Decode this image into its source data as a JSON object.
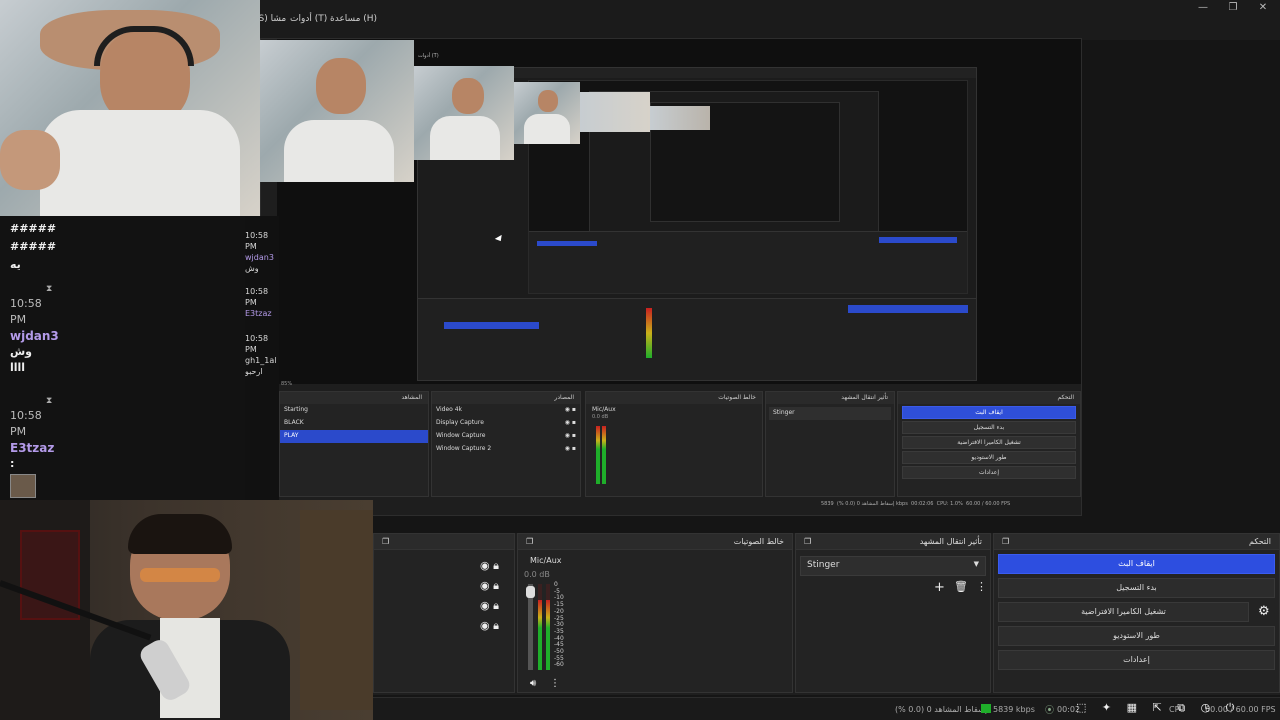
{
  "menubar": {
    "help": "مساعدة (H)",
    "tools": "أدوات (T)",
    "scenes_menu": "(S) مشا"
  },
  "window_controls": {
    "minimize": "—",
    "maximize": "❐",
    "close": "✕"
  },
  "chat": {
    "lines": [
      {
        "text": "#####"
      },
      {
        "text": "#####"
      },
      {
        "text": "يه"
      },
      {
        "time": "10:58",
        "ampm": "PM",
        "user": "wjdan3",
        "msg": "وش",
        "msg2": ":"
      },
      {
        "msg": "اااا"
      },
      {
        "time": "10:58",
        "ampm": "PM",
        "user": "E3tzaz",
        "msg": ":"
      }
    ]
  },
  "chat_mini": {
    "lines": [
      {
        "time": "10:58",
        "ampm": "PM",
        "user": "wjdan3",
        "msg": "وش"
      },
      {
        "time": "10:58",
        "ampm": "PM",
        "user": "E3tzaz"
      },
      {
        "time": "10:58",
        "ampm": "PM",
        "user": "gh1_1al",
        "msg": "ارحبو"
      }
    ]
  },
  "inner": {
    "toolbar_zoom": "85%",
    "scenes": {
      "title": "المشاهد",
      "items": [
        "Starting",
        "BLACK",
        "PLAY"
      ],
      "selected": 2
    },
    "sources": {
      "title": "المصادر",
      "items": [
        "Video 4k",
        "Display Capture",
        "Window Capture",
        "Window Capture 2"
      ]
    },
    "mixer": {
      "title": "خالط الصوتيات",
      "channel": "Mic/Aux",
      "db": "0.0 dB"
    },
    "transitions": {
      "title": "تأثير انتقال المشهد",
      "value": "Stinger"
    },
    "controls": {
      "title": "التحكم",
      "buttons": [
        "ايقاف البث",
        "بدء التسجيل",
        "تشغيل الكاميرا الافتراضية",
        "طور الاستوديو",
        "إعدادات"
      ]
    },
    "status": {
      "dropped": "إسقاط المشاهد 0 (0.0 %)",
      "kbps": "5839 kbps",
      "time": "00:02:06",
      "cpu": "CPU: 1.0%",
      "fps": "60.00 / 60.00 FPS"
    }
  },
  "bottom": {
    "mixer": {
      "title": "خالط الصوتيات",
      "channel": "Mic/Aux",
      "db": "0.0 dB",
      "ticks": [
        "0",
        "-5",
        "-10",
        "-15",
        "-20",
        "-25",
        "-30",
        "-35",
        "-40",
        "-45",
        "-50",
        "-55",
        "-60"
      ]
    },
    "transitions": {
      "title": "تأثير انتقال المشهد",
      "value": "Stinger"
    },
    "controls": {
      "title": "التحكم",
      "buttons": [
        "ايقاف البث",
        "بدء التسجيل",
        "تشغيل الكاميرا الافتراضية",
        "طور الاستوديو",
        "إعدادات"
      ]
    },
    "status": {
      "dropped": "إسقاط المشاهد 0 (0.0 %)",
      "kbps": "5839 kbps",
      "time": "00:02",
      "cpu": "CPU",
      "fps": "60.00 / 60.00 FPS"
    }
  },
  "colors": {
    "accent": "#2d4ee0",
    "meter_green": "#1fae2a",
    "meter_yellow": "#c9b01a",
    "meter_red": "#c92020",
    "username": "#b39ae8"
  }
}
